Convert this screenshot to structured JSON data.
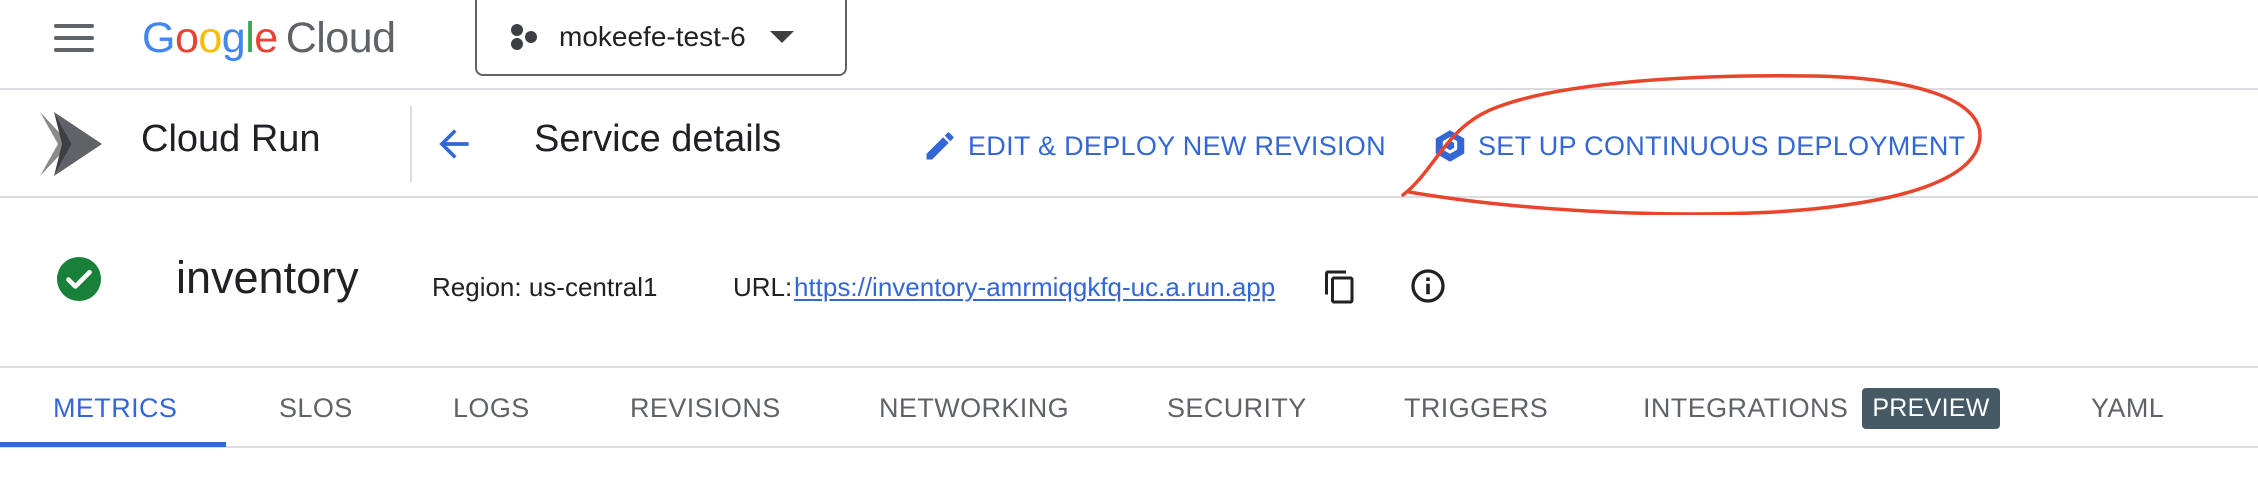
{
  "topbar": {
    "logo_letters": [
      "G",
      "o",
      "o",
      "g",
      "l",
      "e"
    ],
    "logo_suffix": "Cloud",
    "project_name": "mokeefe-test-6"
  },
  "service_header": {
    "product_name": "Cloud Run",
    "page_title": "Service details",
    "actions": {
      "edit_deploy": "EDIT & DEPLOY NEW REVISION",
      "continuous_deployment": "SET UP CONTINUOUS DEPLOYMENT"
    }
  },
  "service": {
    "name": "inventory",
    "region_text": "Region: us-central1",
    "url_label": "URL:",
    "url": "https://inventory-amrmiqgkfq-uc.a.run.app",
    "status": "ok"
  },
  "tabs": [
    {
      "label": "METRICS",
      "active": true
    },
    {
      "label": "SLOS",
      "active": false
    },
    {
      "label": "LOGS",
      "active": false
    },
    {
      "label": "REVISIONS",
      "active": false
    },
    {
      "label": "NETWORKING",
      "active": false
    },
    {
      "label": "SECURITY",
      "active": false
    },
    {
      "label": "TRIGGERS",
      "active": false
    },
    {
      "label": "INTEGRATIONS",
      "active": false,
      "badge": "PREVIEW"
    },
    {
      "label": "YAML",
      "active": false
    }
  ],
  "icons": {
    "menu": "hamburger-menu-icon",
    "project": "project-dots-icon",
    "product": "cloud-run-logo",
    "back": "back-arrow-icon",
    "edit": "pencil-icon",
    "deploy": "cloud-build-hexagon-icon",
    "status": "check-circle-icon",
    "copy": "copy-icon",
    "info": "info-icon"
  },
  "colors": {
    "accent": "#3367d6",
    "status_ok": "#188038",
    "annotation": "#e8452c",
    "badge_bg": "#455a64"
  }
}
